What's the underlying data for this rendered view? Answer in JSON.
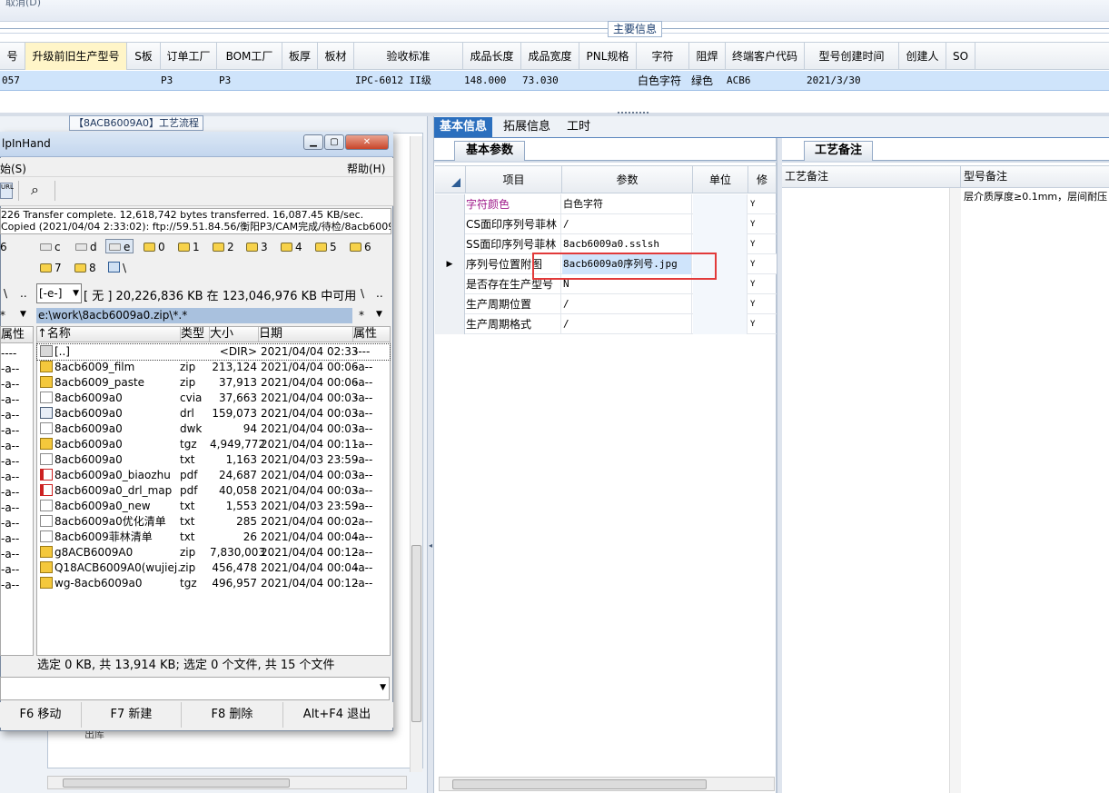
{
  "top": {
    "strip_text": "取消(D)",
    "section_title": "主要信息"
  },
  "main_grid": {
    "columns": [
      "号",
      "升级前旧生产型号",
      "S板",
      "订单工厂",
      "BOM工厂",
      "板厚",
      "板材",
      "验收标准",
      "成品长度",
      "成品宽度",
      "PNL规格",
      "字符",
      "阻焊",
      "终端客户代码",
      "型号创建时间",
      "创建人",
      "SO"
    ],
    "row": {
      "c0": "057",
      "s_board": "P3",
      "bom_factory": "P3",
      "standard": "IPC-6012 II级",
      "length": "148.000",
      "width": "73.030",
      "char": "白色字符",
      "mask": "绿色",
      "customer": "ACB6",
      "created": "2021/3/30"
    }
  },
  "left_panel": {
    "tab": "【8ACB6009A0】工艺流程",
    "bg_row": "出库"
  },
  "right": {
    "tabs": [
      "基本信息",
      "拓展信息",
      "工时"
    ],
    "params_tab": "基本参数",
    "params_columns": [
      "项目",
      "参数",
      "单位",
      "修"
    ],
    "params_rows": [
      {
        "item": "字符颜色",
        "value": "白色字符",
        "flag": "Y"
      },
      {
        "item": "CS面印序列号菲林",
        "value": "/",
        "flag": "Y"
      },
      {
        "item": "SS面印序列号菲林",
        "value": "8acb6009a0.sslsh",
        "flag": "Y"
      },
      {
        "item": "序列号位置附图",
        "value": "8acb6009a0序列号.jpg",
        "flag": "Y"
      },
      {
        "item": "是否存在生产型号",
        "value": "N",
        "flag": "Y"
      },
      {
        "item": "生产周期位置",
        "value": "/",
        "flag": "Y"
      },
      {
        "item": "生产周期格式",
        "value": "/",
        "flag": "Y"
      }
    ],
    "craft_tab": "工艺备注",
    "craft_columns": [
      "工艺备注",
      "型号备注"
    ],
    "model_note": "层介质厚度≥0.1mm，层间耐压"
  },
  "tc": {
    "title": "lpInHand",
    "menu_left": "始(S)",
    "menu_right": "帮助(H)",
    "log1": "226 Transfer complete. 12,618,742 bytes transferred. 16,087.45 KB/sec.",
    "log2": "Copied (2021/04/04 2:33:02): ftp://59.51.84.56/衡阳P3/CAM完成/待检/8acb6009",
    "drives_row1": [
      "6",
      "c",
      "d",
      "e",
      "0",
      "1",
      "2",
      "3",
      "4",
      "5",
      "6"
    ],
    "drives_row2": [
      "7",
      "8",
      "\\"
    ],
    "drive_select": "[-e-]",
    "free_space": "[ 无 ]  20,226,836 KB 在 123,046,976 KB 中可用",
    "path": "e:\\work\\8acb6009a0.zip\\*.*",
    "side_star": "*",
    "side_attr": "属性",
    "columns": {
      "name": "↑名称",
      "type": "类型",
      "size": "大小",
      "date": "日期",
      "attr": "属性"
    },
    "files": [
      {
        "name": "[..]",
        "type": "",
        "size": "<DIR>",
        "date": "2021/04/04 02:33",
        "attr": "----",
        "icon": "up"
      },
      {
        "name": "8acb6009_film",
        "type": "zip",
        "size": "213,124",
        "date": "2021/04/04 00:06",
        "attr": "-a--",
        "icon": "zip"
      },
      {
        "name": "8acb6009_paste",
        "type": "zip",
        "size": "37,913",
        "date": "2021/04/04 00:06",
        "attr": "-a--",
        "icon": "zip"
      },
      {
        "name": "8acb6009a0",
        "type": "cvia",
        "size": "37,663",
        "date": "2021/04/04 00:03",
        "attr": "-a--",
        "icon": "txt"
      },
      {
        "name": "8acb6009a0",
        "type": "drl",
        "size": "159,073",
        "date": "2021/04/04 00:03",
        "attr": "-a--",
        "icon": "drl"
      },
      {
        "name": "8acb6009a0",
        "type": "dwk",
        "size": "94",
        "date": "2021/04/04 00:03",
        "attr": "-a--",
        "icon": "txt"
      },
      {
        "name": "8acb6009a0",
        "type": "tgz",
        "size": "4,949,772",
        "date": "2021/04/04 00:11",
        "attr": "-a--",
        "icon": "zip"
      },
      {
        "name": "8acb6009a0",
        "type": "txt",
        "size": "1,163",
        "date": "2021/04/03 23:59",
        "attr": "-a--",
        "icon": "txt"
      },
      {
        "name": "8acb6009a0_biaozhu",
        "type": "pdf",
        "size": "24,687",
        "date": "2021/04/04 00:03",
        "attr": "-a--",
        "icon": "pdf"
      },
      {
        "name": "8acb6009a0_drl_map",
        "type": "pdf",
        "size": "40,058",
        "date": "2021/04/04 00:03",
        "attr": "-a--",
        "icon": "pdf"
      },
      {
        "name": "8acb6009a0_new",
        "type": "txt",
        "size": "1,553",
        "date": "2021/04/03 23:59",
        "attr": "-a--",
        "icon": "txt"
      },
      {
        "name": "8acb6009a0优化清单",
        "type": "txt",
        "size": "285",
        "date": "2021/04/04 00:02",
        "attr": "-a--",
        "icon": "txt"
      },
      {
        "name": "8acb6009菲林清单",
        "type": "txt",
        "size": "26",
        "date": "2021/04/04 00:04",
        "attr": "-a--",
        "icon": "txt"
      },
      {
        "name": "g8ACB6009A0",
        "type": "zip",
        "size": "7,830,003",
        "date": "2021/04/04 00:12",
        "attr": "-a--",
        "icon": "zip"
      },
      {
        "name": "Q18ACB6009A0(wujiej..",
        "type": "zip",
        "size": "456,478",
        "date": "2021/04/04 00:04",
        "attr": "-a--",
        "icon": "zip"
      },
      {
        "name": "wg-8acb6009a0",
        "type": "tgz",
        "size": "496,957",
        "date": "2021/04/04 00:12",
        "attr": "-a--",
        "icon": "zip"
      }
    ],
    "status": "选定 0 KB, 共 13,914 KB; 选定 0 个文件, 共 15 个文件",
    "fkeys": [
      "F6 移动",
      "F7 新建",
      "F8 删除",
      "Alt+F4 退出"
    ]
  }
}
